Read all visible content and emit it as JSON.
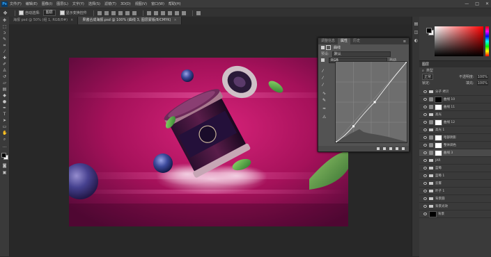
{
  "app": {
    "logo_text": "Ps"
  },
  "menu": [
    "文件(F)",
    "编辑(E)",
    "图像(I)",
    "图层(L)",
    "文字(Y)",
    "选择(S)",
    "滤镜(T)",
    "3D(D)",
    "视图(V)",
    "窗口(W)",
    "帮助(H)"
  ],
  "options": {
    "auto_select_label": "自动选择:",
    "auto_select_value": "图层",
    "transform_label": "显示变换控件"
  },
  "tabs": [
    {
      "label": "海报 psd @ 50% (组 1, RGB/8#)",
      "active": false
    },
    {
      "label": "果酱合成海报.psd @ 100% (曲线 3, 图层蒙版/8/CMYK)",
      "active": true
    }
  ],
  "properties": {
    "tabs": [
      "调整信息",
      "属性",
      "历史"
    ],
    "title": "曲线",
    "preset_label": "预设:",
    "preset_value": "默认",
    "channel": "RGB",
    "auto_label": "自动"
  },
  "curve_points": [
    [
      0,
      0
    ],
    [
      0.25,
      0.2
    ],
    [
      0.55,
      0.5
    ],
    [
      1,
      1
    ]
  ],
  "layers": {
    "tab": "图层",
    "kind_label": "类型",
    "blend_mode": "正常",
    "opacity_label": "不透明度:",
    "opacity": "100%",
    "lock_label": "锁定:",
    "fill_label": "填充:",
    "fill": "100%",
    "items": [
      {
        "name": "分子 拷贝",
        "kind": "folder",
        "selected": false
      },
      {
        "name": "曲线 10",
        "kind": "adj-black",
        "selected": false
      },
      {
        "name": "曲线 11",
        "kind": "adj-white",
        "selected": false
      },
      {
        "name": "高光",
        "kind": "folder",
        "selected": false
      },
      {
        "name": "曲线 12",
        "kind": "adj-white",
        "selected": false
      },
      {
        "name": "高光 1",
        "kind": "folder",
        "selected": false
      },
      {
        "name": "暗部阴影",
        "kind": "adj-white",
        "selected": false
      },
      {
        "name": "整体调色",
        "kind": "adj-white",
        "selected": false
      },
      {
        "name": "曲线 3",
        "kind": "adj-white",
        "selected": true
      },
      {
        "name": "JAR",
        "kind": "folder",
        "selected": false
      },
      {
        "name": "蓝莓",
        "kind": "folder",
        "selected": false
      },
      {
        "name": "蓝莓 1",
        "kind": "folder",
        "selected": false
      },
      {
        "name": "云雾",
        "kind": "folder",
        "selected": false
      },
      {
        "name": "叶子 1",
        "kind": "folder",
        "selected": false
      },
      {
        "name": "背景圆",
        "kind": "folder",
        "selected": false
      },
      {
        "name": "背景光效",
        "kind": "folder",
        "selected": false
      },
      {
        "name": "背景",
        "kind": "black",
        "selected": false
      }
    ]
  },
  "colors": {
    "accent": "#31a8ff",
    "canvas_magenta": "#c2115f",
    "panel": "#535353"
  }
}
